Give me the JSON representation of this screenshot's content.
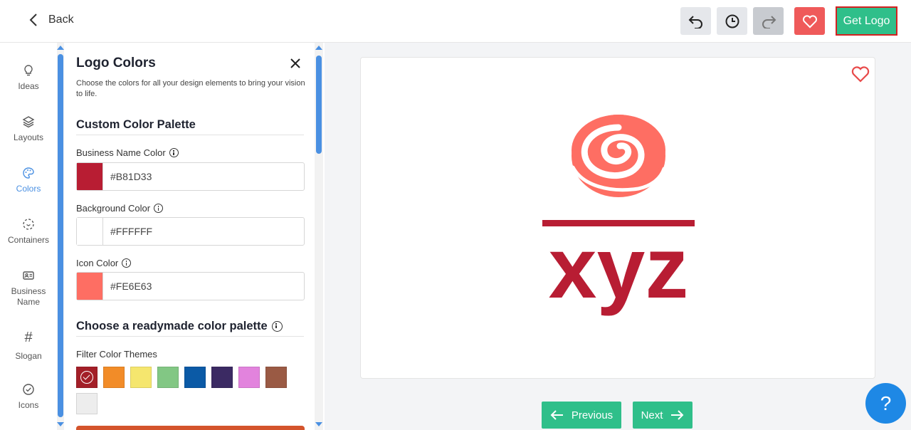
{
  "topbar": {
    "back_label": "Back",
    "get_logo_label": "Get Logo"
  },
  "rail": {
    "items": [
      {
        "label": "Ideas",
        "icon": "lightbulb-icon"
      },
      {
        "label": "Layouts",
        "icon": "layers-icon"
      },
      {
        "label": "Colors",
        "icon": "palette-icon",
        "active": true
      },
      {
        "label": "Containers",
        "icon": "container-icon"
      },
      {
        "label": "Business Name",
        "icon": "id-card-icon"
      },
      {
        "label": "Slogan",
        "icon": "hash-icon"
      },
      {
        "label": "Icons",
        "icon": "check-circle-icon"
      }
    ]
  },
  "panel": {
    "title": "Logo Colors",
    "description": "Choose the colors for all your design elements to bring your vision to life.",
    "custom_heading": "Custom Color Palette",
    "fields": [
      {
        "label": "Business Name Color",
        "value": "#B81D33",
        "swatch": "#B81D33"
      },
      {
        "label": "Background Color",
        "value": "#FFFFFF",
        "swatch": "#FFFFFF"
      },
      {
        "label": "Icon Color",
        "value": "#FE6E63",
        "swatch": "#FE6E63"
      }
    ],
    "readymade_heading": "Choose a readymade color palette",
    "filter_label": "Filter Color Themes",
    "themes": [
      "#a31f28",
      "#f28c28",
      "#f5e66e",
      "#82c784",
      "#0b5aa6",
      "#3b2a63",
      "#e283dd",
      "#9a5a44",
      "#ededed"
    ]
  },
  "preview": {
    "business_name": "xyz",
    "name_color": "#B81D33",
    "icon_color": "#FE6E63"
  },
  "nav": {
    "previous_label": "Previous",
    "next_label": "Next"
  },
  "help": {
    "label": "?"
  }
}
